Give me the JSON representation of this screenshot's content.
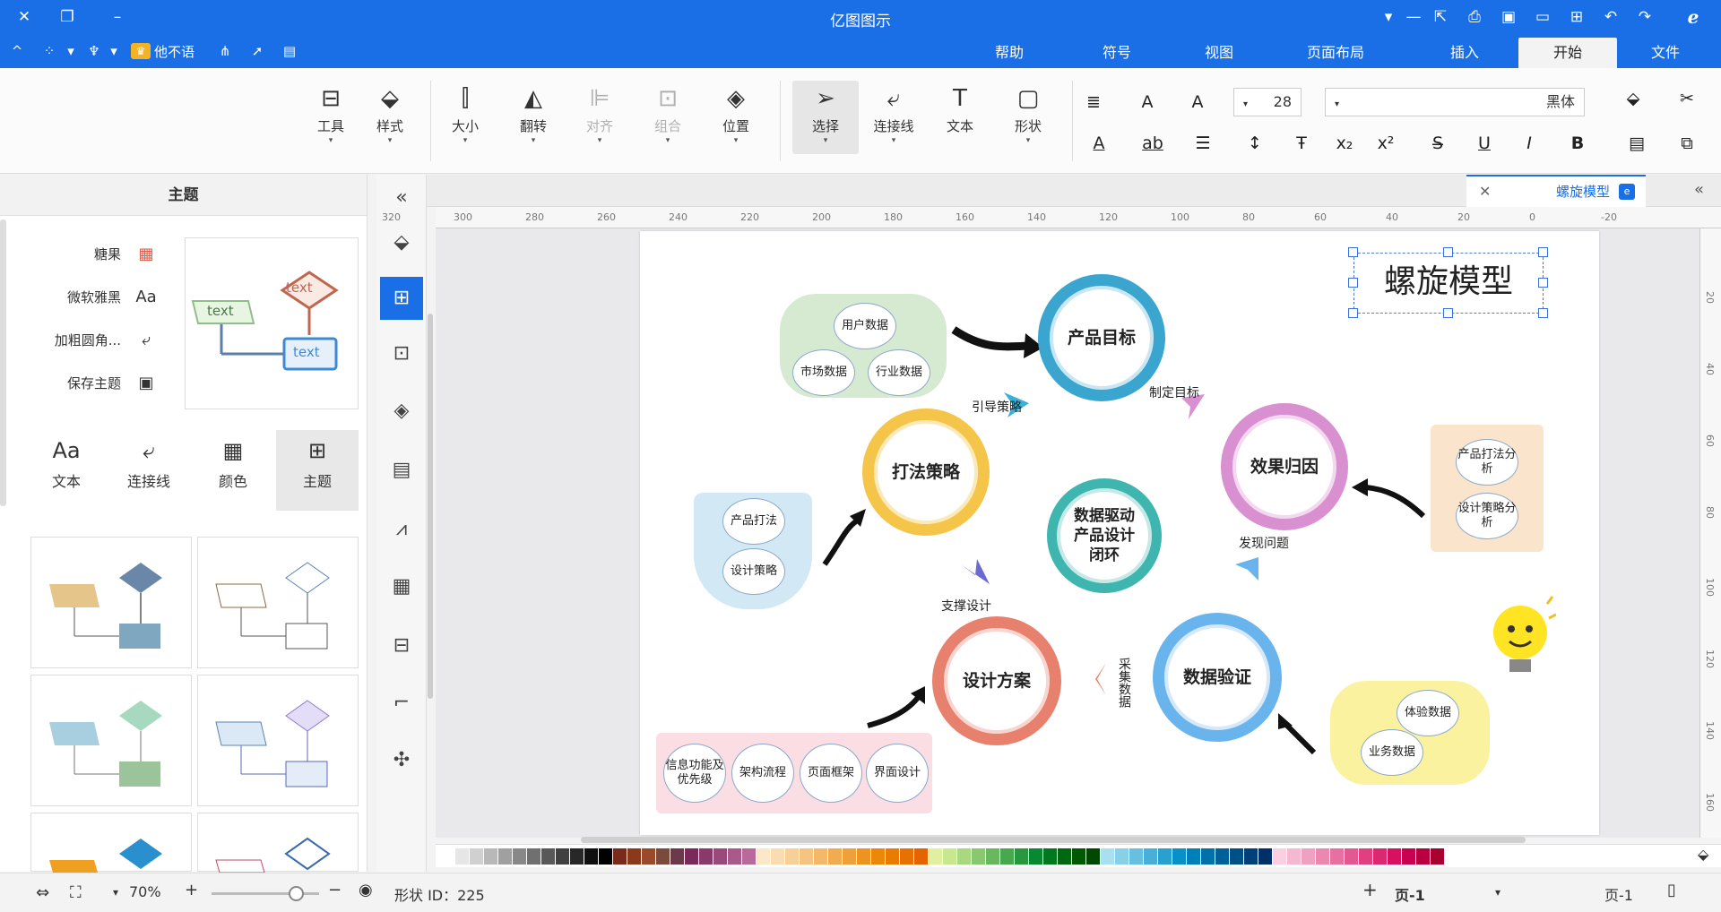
{
  "app": {
    "title": "亿图图示"
  },
  "menu": {
    "tabs": [
      "文件",
      "开始",
      "插入",
      "页面布局",
      "视图",
      "符号",
      "帮助"
    ],
    "active_tab": "开始",
    "user_name": "他不语"
  },
  "ribbon": {
    "font_name": "黑体",
    "font_size": "28",
    "buttons": {
      "shape": "形状",
      "text": "文本",
      "connector": "连接线",
      "select": "选择",
      "position": "位置",
      "group": "组合",
      "align": "对齐",
      "rotate": "翻转",
      "size": "大小",
      "style": "样式",
      "tools": "工具"
    }
  },
  "left_panel": {
    "header": "主题",
    "options": [
      "糖果",
      "微软雅黑",
      "加粗圆角...",
      "保存主题"
    ],
    "tabs": [
      "主题",
      "颜色",
      "连接线",
      "文本"
    ],
    "active_tab": "主题",
    "preview_labels": [
      "text",
      "text",
      "text"
    ]
  },
  "document": {
    "tab_name": "螺旋模型",
    "ruler_h": [
      "-20",
      "0",
      "20",
      "40",
      "60",
      "80",
      "100",
      "120",
      "140",
      "160",
      "180",
      "200",
      "220",
      "240",
      "260",
      "280",
      "300",
      "320"
    ],
    "ruler_v": [
      "20",
      "40",
      "60",
      "80",
      "100",
      "120",
      "140",
      "160"
    ]
  },
  "diagram": {
    "title": "螺旋模型",
    "circles": {
      "product_goal": "产品目标",
      "strategy": "打法策略",
      "center": "数据驱动产品设计闭环",
      "attribution": "效果归因",
      "design": "设计方案",
      "validation": "数据验证"
    },
    "labels": {
      "lead_strategy": "引导策略",
      "define_goal": "制定目标",
      "support_design": "支撑设计",
      "discover": "发现问题",
      "collect_data": "采集数据"
    },
    "inputs_goal": [
      "用户数据",
      "市场数据",
      "行业数据"
    ],
    "inputs_strategy": [
      "产品打法",
      "设计策略"
    ],
    "inputs_attribution": [
      "产品打法分析",
      "设计策略分析"
    ],
    "inputs_validation": [
      "体验数据",
      "业务数据"
    ],
    "inputs_design": [
      "信息功能及优先级",
      "架构流程",
      "页面框架",
      "界面设计"
    ]
  },
  "status": {
    "page_label": "页-1",
    "page_tab": "页-1",
    "add_page": "+",
    "shape_id": "形状 ID：225",
    "zoom": "70%"
  },
  "colors": {
    "accent": "#1a6fe6",
    "goal_ring": "#3aa6d0",
    "strategy_ring": "#f5c54a",
    "center_ring": "#3fb5b0",
    "attribution_ring": "#d890d0",
    "design_ring": "#e8806e",
    "validation_ring": "#6ab4ee"
  }
}
